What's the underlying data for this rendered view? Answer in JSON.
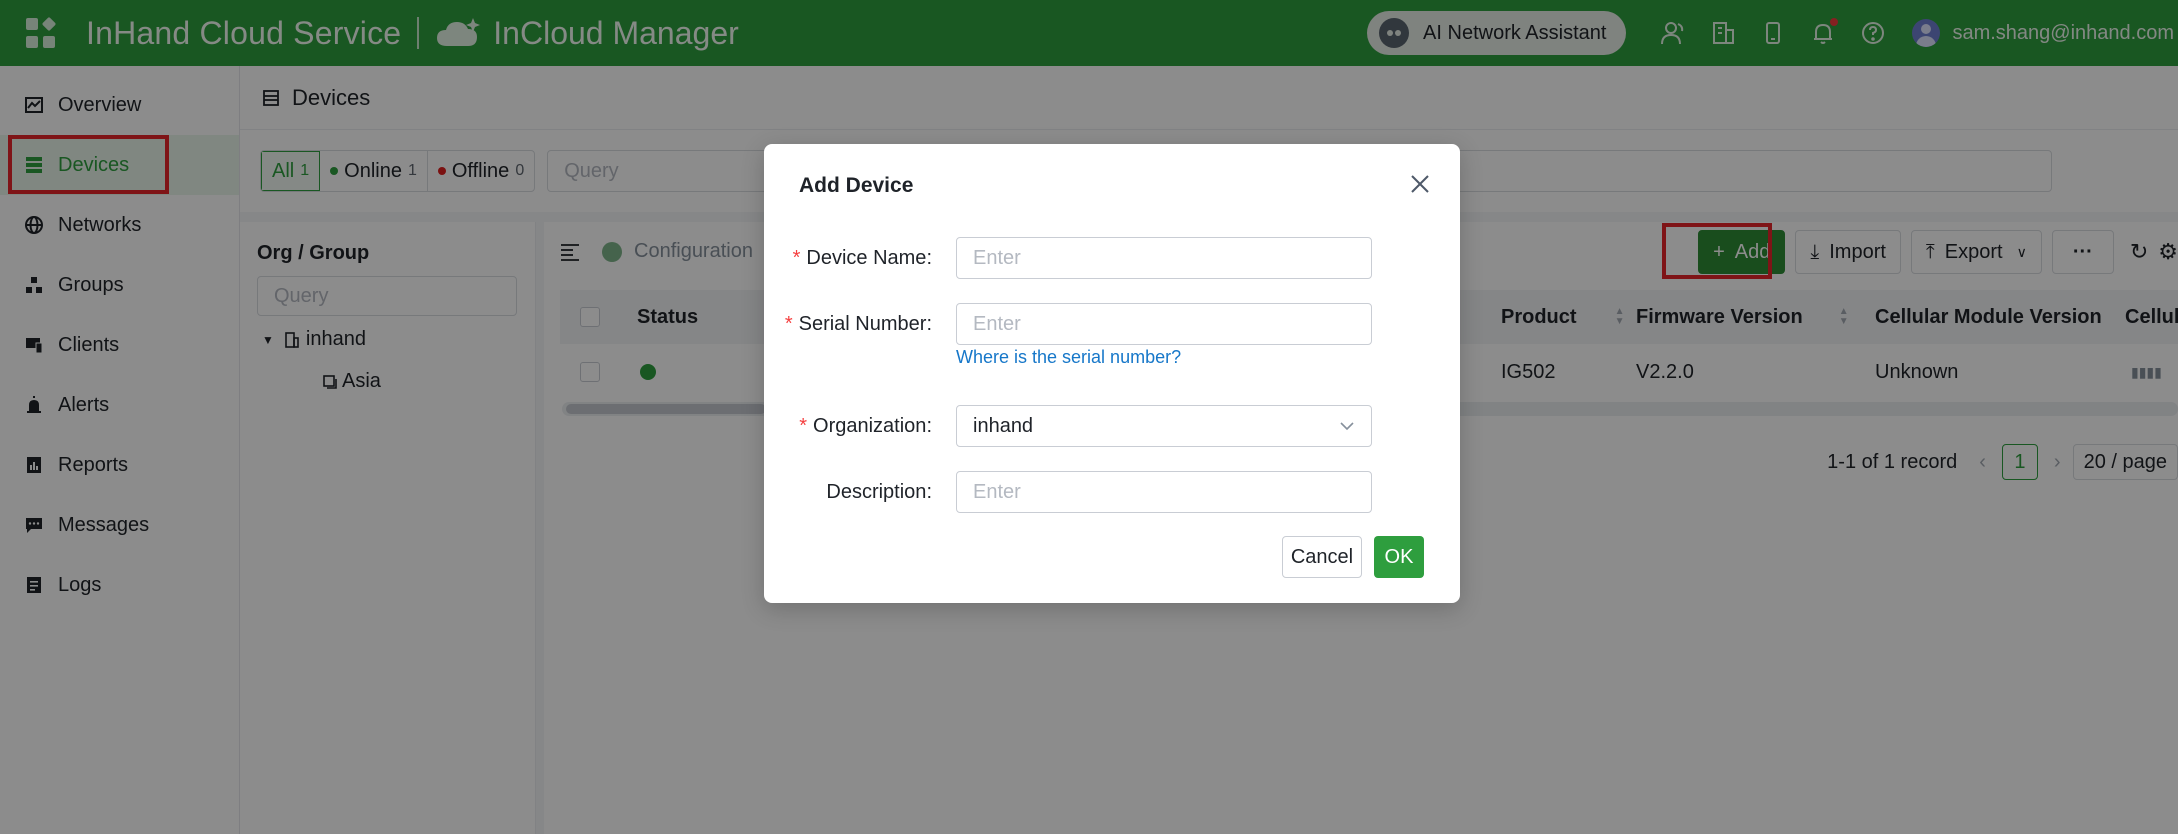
{
  "topbar": {
    "brand": "InHand Cloud Service",
    "product": "InCloud Manager",
    "ai_assistant": "AI Network Assistant",
    "user_email": "sam.shang@inhand.com",
    "icons": [
      "apps-icon",
      "cloud-icon",
      "robot-icon",
      "users-icon",
      "building-icon",
      "device-icon",
      "bell-icon",
      "help-icon",
      "avatar-icon"
    ],
    "accent": "#2e9e3e"
  },
  "sidebar": {
    "items": [
      {
        "label": "Overview",
        "icon": "chart-icon"
      },
      {
        "label": "Devices",
        "icon": "server-icon",
        "active": true
      },
      {
        "label": "Networks",
        "icon": "globe-icon"
      },
      {
        "label": "Groups",
        "icon": "groups-icon"
      },
      {
        "label": "Clients",
        "icon": "clients-icon"
      },
      {
        "label": "Alerts",
        "icon": "alarm-icon"
      },
      {
        "label": "Reports",
        "icon": "report-icon"
      },
      {
        "label": "Messages",
        "icon": "message-icon"
      },
      {
        "label": "Logs",
        "icon": "log-icon"
      }
    ]
  },
  "page": {
    "title": "Devices",
    "filters": {
      "all_label": "All",
      "all_count": "1",
      "online_label": "Online",
      "online_count": "1",
      "offline_label": "Offline",
      "offline_count": "0"
    },
    "query_placeholder": "Query"
  },
  "org_panel": {
    "title": "Org / Group",
    "query_placeholder": "Query",
    "root": "inhand",
    "child": "Asia"
  },
  "table": {
    "toolbar_tab": "Configuration",
    "buttons": {
      "add": "Add",
      "import": "Import",
      "export": "Export",
      "more": "···"
    },
    "headers": {
      "status": "Status",
      "product": "Product",
      "firmware": "Firmware Version",
      "cellular_module": "Cellular Module Version",
      "cellular": "Cellul"
    },
    "rows": [
      {
        "status_color": "#2e9e3e",
        "product": "IG502",
        "firmware": "V2.2.0",
        "cellular_module": "Unknown"
      }
    ],
    "pager": {
      "summary": "1-1 of 1 record",
      "page": "1",
      "page_size": "20 / page"
    }
  },
  "modal": {
    "title": "Add Device",
    "fields": {
      "device_name": {
        "label": "Device Name",
        "placeholder": "Enter"
      },
      "serial_number": {
        "label": "Serial Number",
        "placeholder": "Enter"
      },
      "organization": {
        "label": "Organization",
        "value": "inhand"
      },
      "description": {
        "label": "Description",
        "placeholder": "Enter"
      }
    },
    "help_link": "Where is the serial number?",
    "cancel": "Cancel",
    "ok": "OK"
  }
}
